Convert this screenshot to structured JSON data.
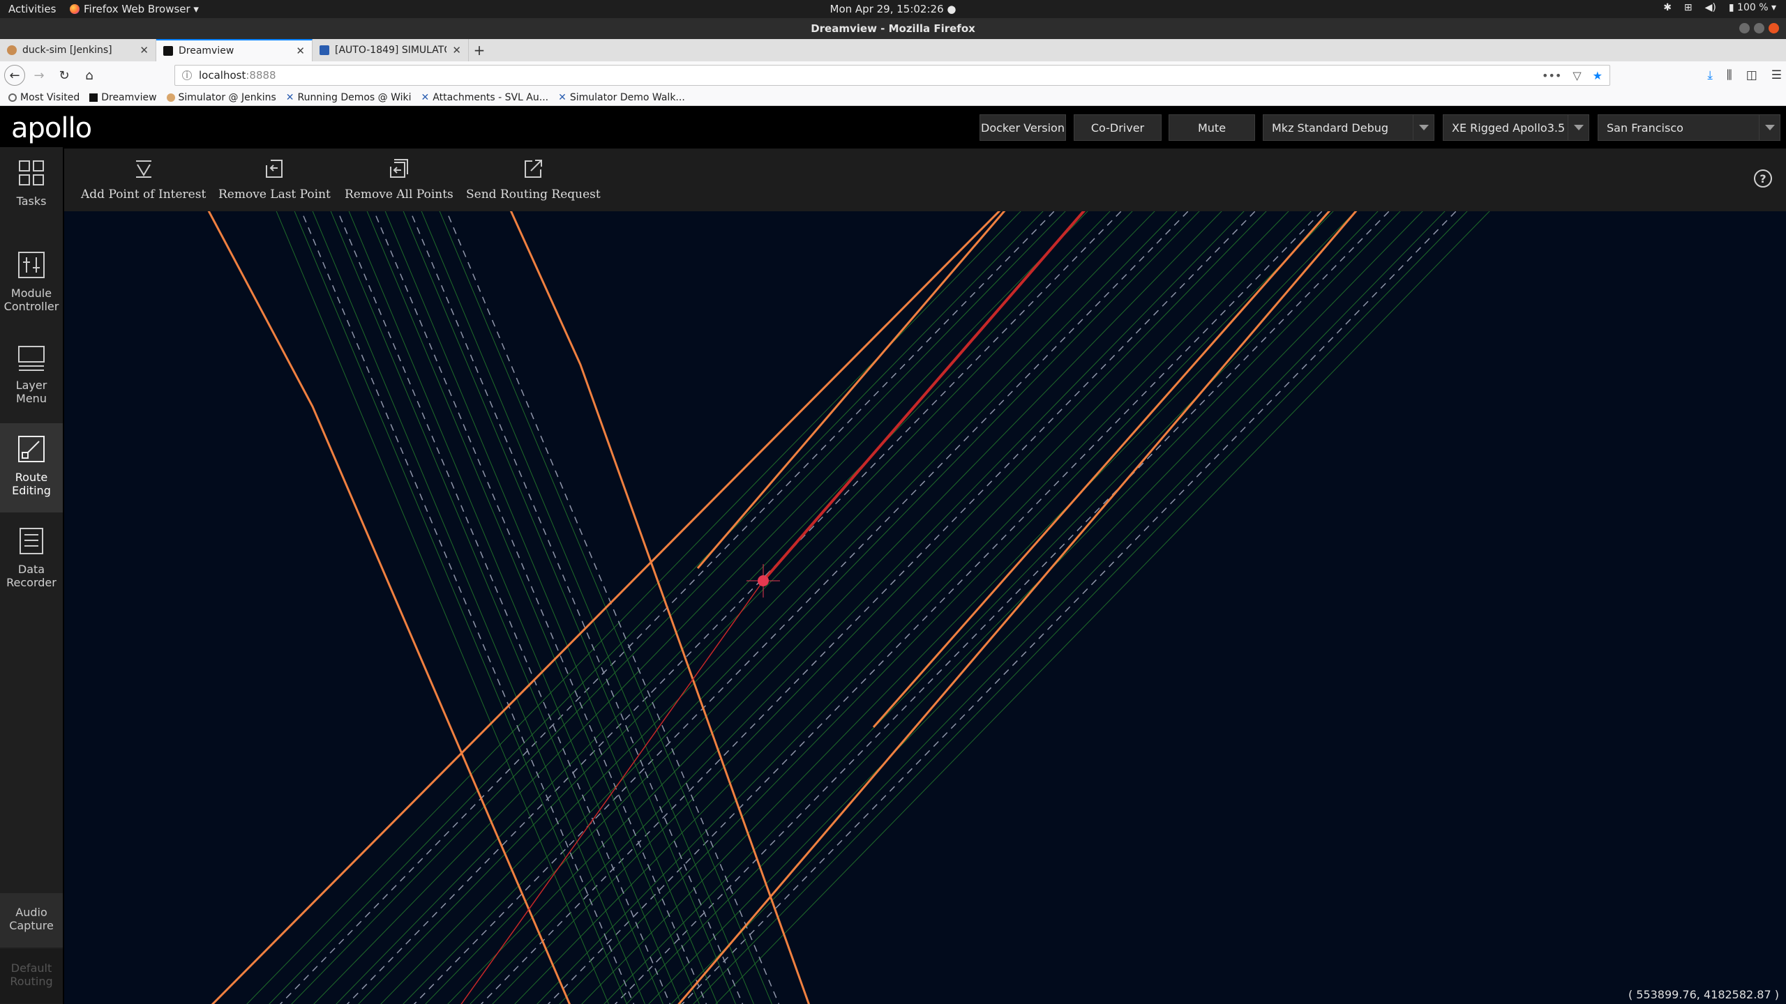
{
  "gnome": {
    "activities": "Activities",
    "app_menu": "Firefox Web Browser ▾",
    "clock": "Mon Apr 29, 15:02:26 ●",
    "battery": "100 % ▾"
  },
  "window": {
    "title": "Dreamview - Mozilla Firefox"
  },
  "tabs": [
    {
      "label": "duck-sim [Jenkins]"
    },
    {
      "label": "Dreamview"
    },
    {
      "label": "[AUTO-1849] SIMULATOR"
    }
  ],
  "url": {
    "host": "localhost",
    "port": ":8888"
  },
  "bookmarks": [
    {
      "label": "Most Visited"
    },
    {
      "label": "Dreamview"
    },
    {
      "label": "Simulator @ Jenkins"
    },
    {
      "label": "Running Demos @ Wiki"
    },
    {
      "label": "Attachments - SVL Au..."
    },
    {
      "label": "Simulator Demo Walk..."
    }
  ],
  "apollo": {
    "logo": "apollo",
    "buttons": {
      "docker": "Docker Version",
      "codriver": "Co-Driver",
      "mute": "Mute"
    },
    "selects": {
      "mode": "Mkz Standard Debug",
      "vehicle": "XE Rigged Apollo3.5",
      "map": "San Francisco"
    }
  },
  "sidemenu": {
    "tasks": "Tasks",
    "module_controller": [
      "Module",
      "Controller"
    ],
    "layer_menu": [
      "Layer",
      "Menu"
    ],
    "route_editing": [
      "Route",
      "Editing"
    ],
    "data_recorder": [
      "Data",
      "Recorder"
    ],
    "audio_capture": [
      "Audio",
      "Capture"
    ],
    "default_routing": [
      "Default",
      "Routing"
    ]
  },
  "toolbar": {
    "add_poi": "Add Point of Interest",
    "remove_last": "Remove Last Point",
    "remove_all": "Remove All Points",
    "send_routing": "Send Routing Request",
    "help": "?"
  },
  "map": {
    "coordinates": "( 553899.76, 4182582.87 )",
    "colors": {
      "background": "#020b1c",
      "curb": "#f08040",
      "lane_green": "#1f6b2a",
      "lane_dash": "#8f96aa",
      "route": "#c62828",
      "marker": "#e53950"
    }
  }
}
